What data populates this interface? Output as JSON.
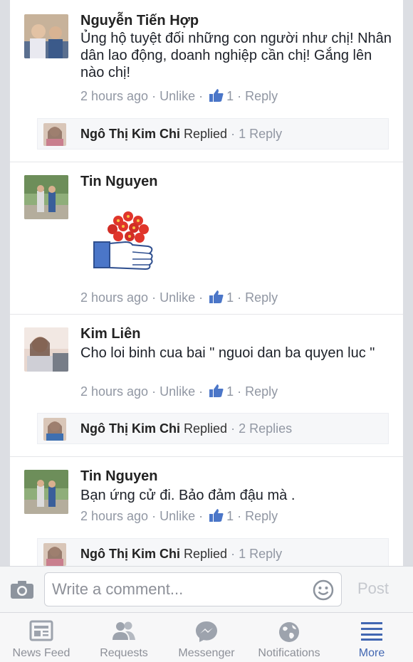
{
  "comments": [
    {
      "author": "Nguyễn Tiến Hợp",
      "text": "Ủng hộ tuyệt đối những con người như chị! Nhân dân lao động, doanh nghiệp cần chị! Gắng lên nào chị!",
      "time": "2 hours ago",
      "unlike": "Unlike",
      "likes": "1",
      "reply": "Reply",
      "replies_preview": {
        "author": "Ngô Thị Kim Chi",
        "verb": "Replied",
        "count": "1 Reply"
      }
    },
    {
      "author": "Tin Nguyen",
      "sticker": "flower-like-sticker",
      "time": "2 hours ago",
      "unlike": "Unlike",
      "likes": "1",
      "reply": "Reply"
    },
    {
      "author": "Kim Liên",
      "text": "Cho loi binh cua bai \" nguoi dan ba quyen luc \"",
      "time": "2 hours ago",
      "unlike": "Unlike",
      "likes": "1",
      "reply": "Reply",
      "replies_preview": {
        "author": "Ngô Thị Kim Chi",
        "verb": "Replied",
        "count": "2 Replies"
      }
    },
    {
      "author": "Tin Nguyen",
      "text": "Bạn ứng cử đi. Bảo đảm đậu mà .",
      "time": "2 hours ago",
      "unlike": "Unlike",
      "likes": "1",
      "reply": "Reply",
      "replies_preview": {
        "author": "Ngô Thị Kim Chi",
        "verb": "Replied",
        "count": "1 Reply"
      }
    }
  ],
  "composer": {
    "placeholder": "Write a comment...",
    "post_label": "Post",
    "camera_icon": "camera-icon",
    "emoji_icon": "smiley-icon"
  },
  "tabs": [
    {
      "label": "News Feed",
      "icon": "news-feed-icon",
      "active": false
    },
    {
      "label": "Requests",
      "icon": "friend-requests-icon",
      "active": false
    },
    {
      "label": "Messenger",
      "icon": "messenger-icon",
      "active": false
    },
    {
      "label": "Notifications",
      "icon": "globe-icon",
      "active": false
    },
    {
      "label": "More",
      "icon": "menu-icon",
      "active": true
    }
  ],
  "colors": {
    "link_blue": "#4267b2",
    "meta_gray": "#9197a3",
    "sticker_red": "#e0352b"
  }
}
